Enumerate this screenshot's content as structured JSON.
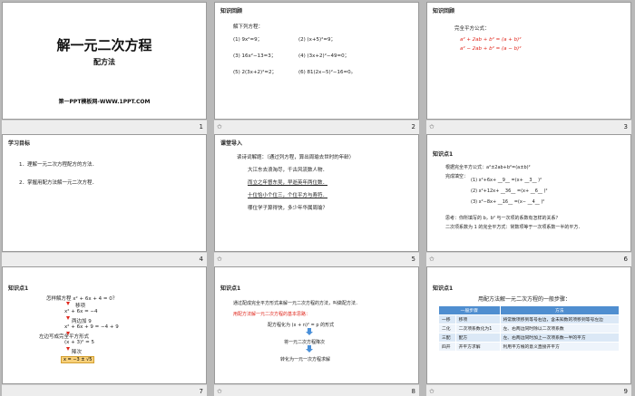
{
  "slides": [
    {
      "num": "1",
      "title": "解一元二次方程",
      "subtitle": "配方法",
      "footer": "第一PPT模板网-WWW.1PPT.COM"
    },
    {
      "num": "2",
      "header": "知识回顾",
      "lead": "解下列方程：",
      "items": [
        "(1) 9x²=9；",
        "(2) (x+5)²=9；",
        "(3) 16x²−13=3；",
        "(4) (3x+2)²−49=0；",
        "(5) 2(3x+2)²=2；",
        "(6) 81(2x−5)²−16=0。"
      ]
    },
    {
      "num": "3",
      "header": "知识回顾",
      "lead": "完全平方公式：",
      "formula1": "a² + 2ab + b² = (a + b)²",
      "formula2": "a² − 2ab + b² = (a − b)²"
    },
    {
      "num": "4",
      "header": "学习目标",
      "items": [
        "1．理解一元二次方程配方的方法．",
        "2．掌握用配方法解一元二次方程．"
      ]
    },
    {
      "num": "5",
      "header": "课堂导入",
      "lead": "读诗词解题：（通过列方程，算出周瑜去世时的年龄）",
      "lines": [
        "大江东去浪淘尽，千古风流数人物．",
        "而立之年督东吴，早逝英年两位数．",
        "十位恰小个位三，个位平方与寿符．",
        "哪位学子算得快，多少年华属周瑜？"
      ]
    },
    {
      "num": "6",
      "header": "知识点1",
      "lead": "根据完全平方公式：a²±2ab+b²=(a±b)²",
      "fill": "完成填空：",
      "rows": [
        "(1) x²+6x+ __9__ =(x+ __3__ )²",
        "(2) x²+12x+ __36__ =(x+ __6__ )²",
        "(3) x²−8x+ __16__ =(x− __4__ )²"
      ],
      "think": "思考：你所填写的 b，b² 与一次项的系数有怎样的关系？",
      "answer": "二次项系数为 1 的完全平方式：常数项等于一次项系数一半的平方．"
    },
    {
      "num": "7",
      "header": "知识点1",
      "steps": [
        "怎样解方程 x² + 6x + 4 = 0？",
        "移项",
        "x² + 6x = −4",
        "两边加 9",
        "x² + 6x + 9 = −4 + 9",
        "左边写成完全平方形式",
        "(x + 3)² = 5",
        "降次",
        "x = −3 ± √5"
      ]
    },
    {
      "num": "8",
      "header": "知识点1",
      "lead": "通过配成完全平方形式来解一元二次方程的方法，叫做配方法．",
      "note": "用配方法解一元二次方程的基本思路：",
      "flow": [
        "配方程化为 (x + n)² = p 的形式",
        "将一元二次方程降次",
        "转化为一元一次方程求解"
      ]
    },
    {
      "num": "9",
      "header": "知识点1",
      "lead": "用配方法解一元二次方程的一般步骤：",
      "columns": [
        "一般步骤",
        "方法"
      ],
      "table": [
        [
          "一移",
          "移项",
          "将常数项移到等号右边，含未知数的项移到等号左边"
        ],
        [
          "二化",
          "二次项系数化为1",
          "左、右两边同时除以二次项系数"
        ],
        [
          "三配",
          "配方",
          "左、右两边同时加上一次项系数一半的平方"
        ],
        [
          "四开",
          "开平方求解",
          "利用平方根的意义直接开平方"
        ]
      ]
    }
  ]
}
